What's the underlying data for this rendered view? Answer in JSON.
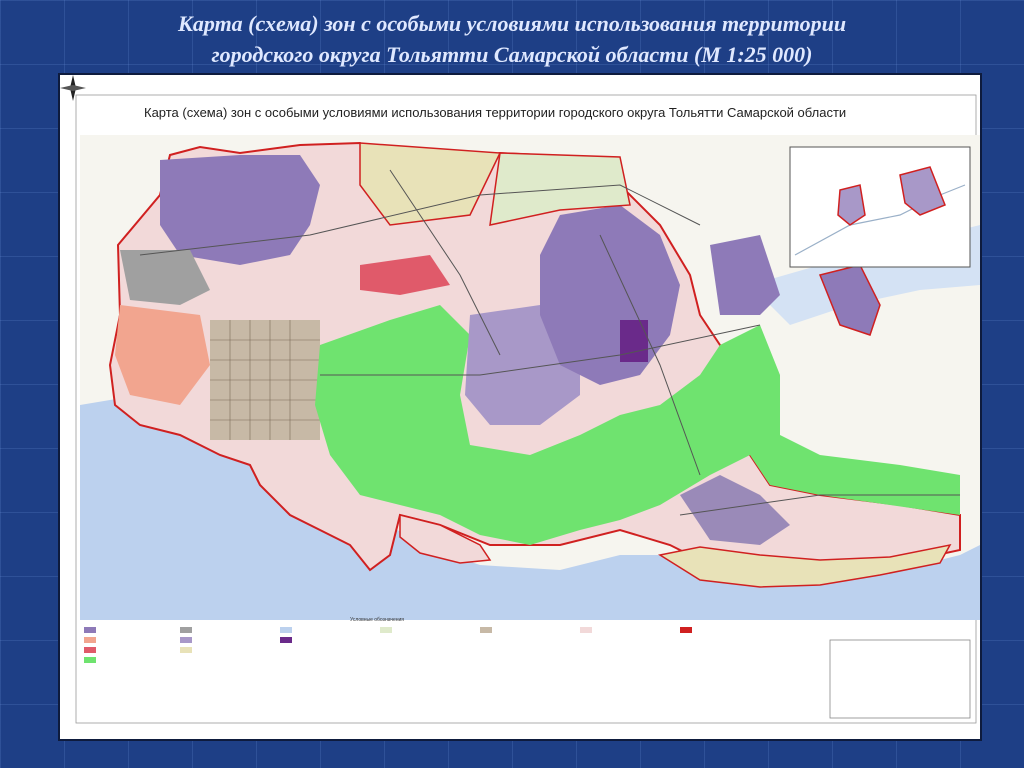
{
  "slide": {
    "title_line1": "Карта (схема) зон с особыми условиями использования территории",
    "title_line2": "городского округа Тольятти Самарской области (М 1:25 000)"
  },
  "map": {
    "heading": "Карта (схема) зон с особыми условиями использования территории городского округа Тольятти Самарской области",
    "legend_title": "Условные обозначения",
    "colors": {
      "water": "#bcd1ee",
      "forest": "#6fe36f",
      "residential": "#a698c6",
      "industrial": "#8e7ab8",
      "public": "#f0a8a8",
      "agricultural": "#e8e2b8",
      "boundary": "#d02020"
    }
  }
}
